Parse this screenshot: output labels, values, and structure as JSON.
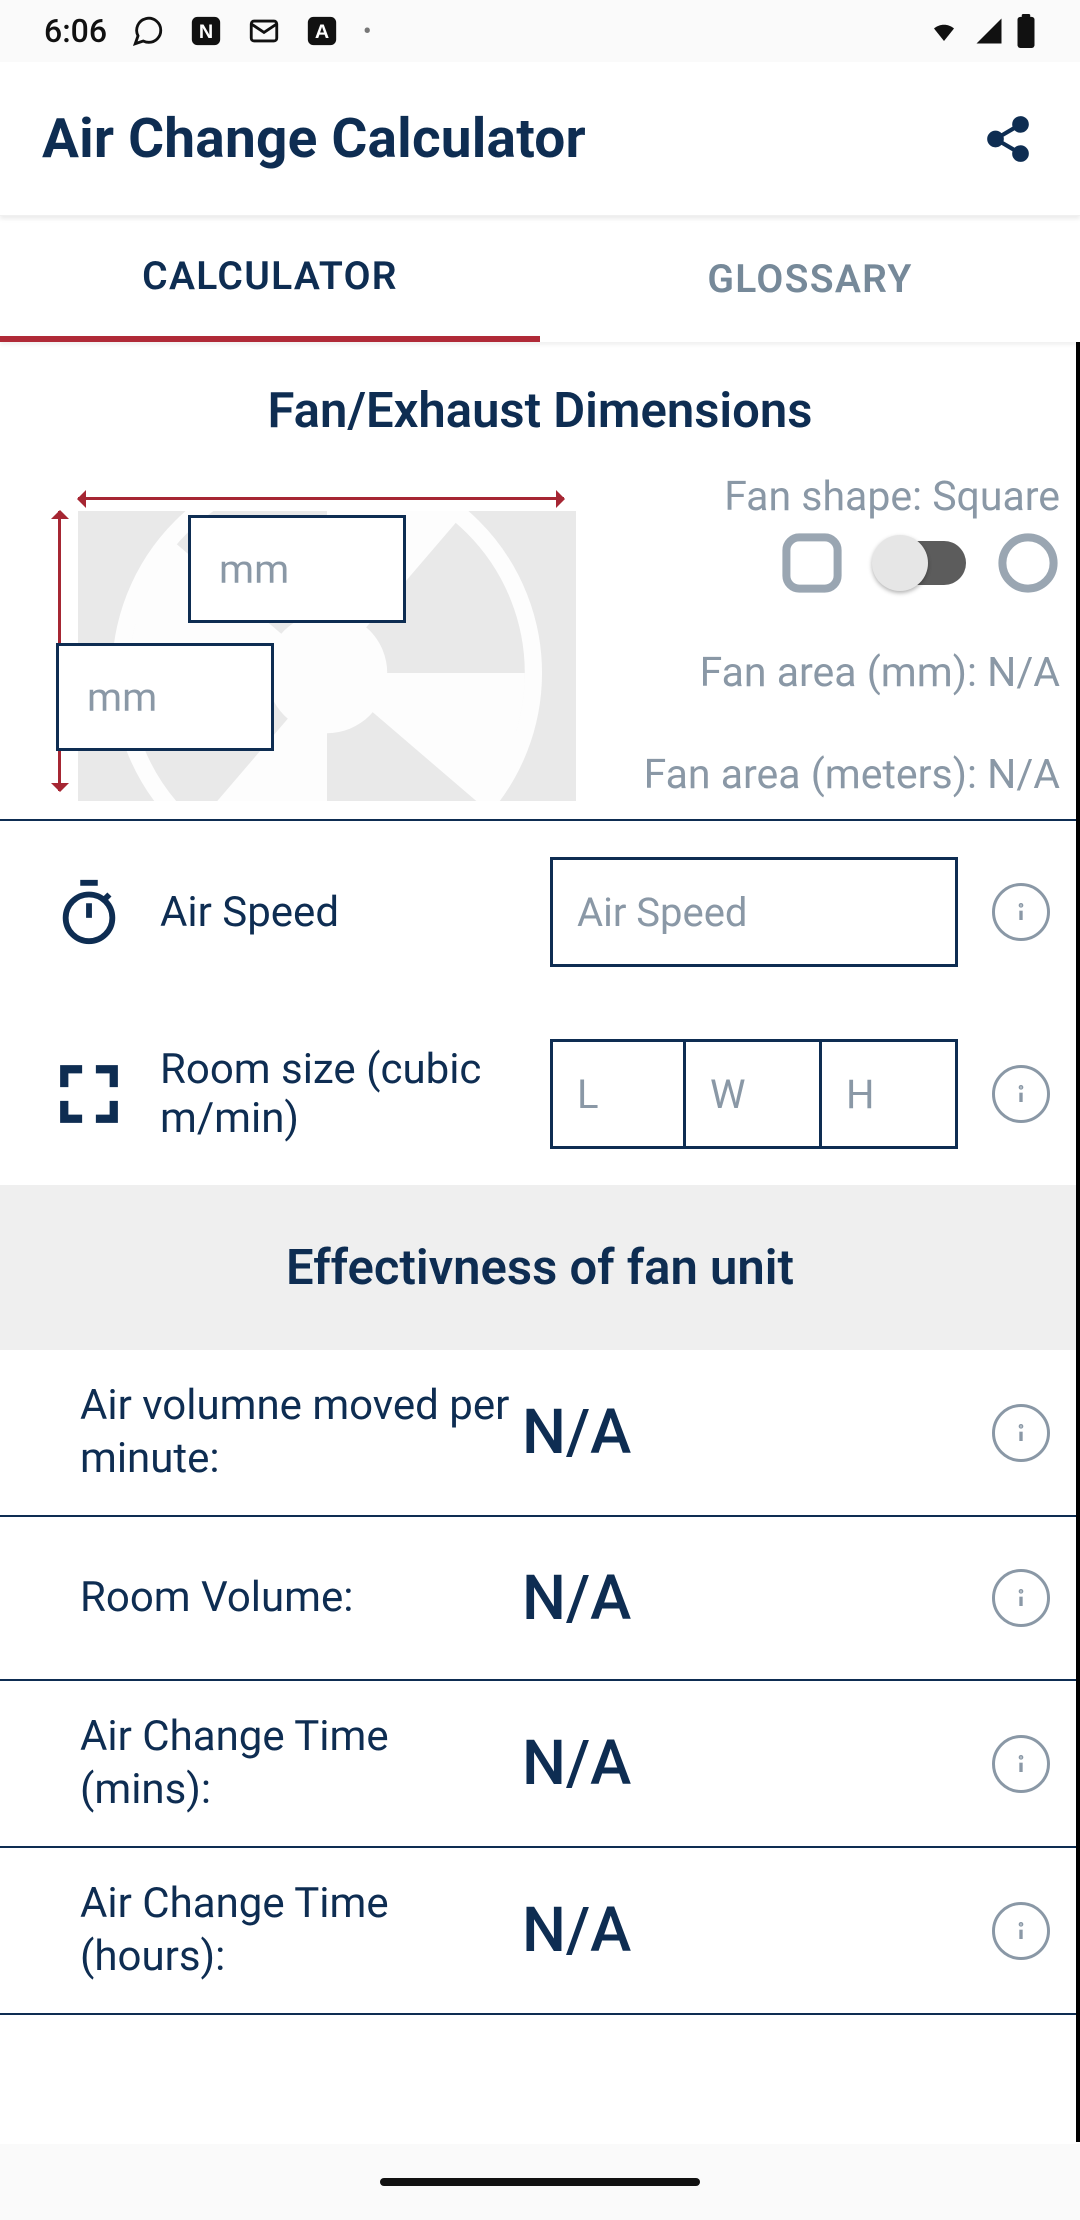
{
  "status": {
    "time": "6:06",
    "battery_level": "full"
  },
  "header": {
    "title": "Air Change Calculator"
  },
  "tabs": {
    "calculator": "CALCULATOR",
    "glossary": "GLOSSARY",
    "active": "calculator"
  },
  "fan_section": {
    "title": "Fan/Exhaust Dimensions",
    "width_placeholder": "mm",
    "height_placeholder": "mm",
    "shape_label": "Fan shape: Square",
    "shape_value": "Square",
    "area_mm_label": "Fan area (mm): N/A",
    "area_m_label": "Fan area (meters): N/A"
  },
  "airspeed": {
    "label": "Air Speed",
    "placeholder": "Air Speed"
  },
  "room": {
    "label": "Room size (cubic m/min)",
    "l_placeholder": "L",
    "w_placeholder": "W",
    "h_placeholder": "H"
  },
  "effect_section": {
    "title": "Effectivness of fan unit"
  },
  "results": {
    "air_volume_label": "Air volumne moved per minute:",
    "air_volume_value": "N/A",
    "room_volume_label": "Room Volume:",
    "room_volume_value": "N/A",
    "act_mins_label": "Air Change Time (mins):",
    "act_mins_value": "N/A",
    "act_hours_label": "Air Change Time (hours):",
    "act_hours_value": "N/A"
  }
}
